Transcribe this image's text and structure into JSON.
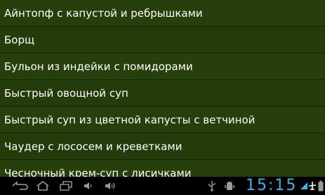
{
  "recipes": [
    "Айнтопф с капустой и ребрышками",
    "Борщ",
    "Бульон из индейки с помидорами",
    "Быстрый овощной суп",
    "Быстрый суп из цветной капусты с ветчиной",
    "Чаудер с лососем и креветками",
    "Чесночный крем-суп с лисичками"
  ],
  "status_bar": {
    "time": "15:15",
    "accent_color": "#33b5e5",
    "icons": [
      "back-icon",
      "home-icon",
      "recent-apps-icon",
      "volume-down-icon",
      "volume-up-icon",
      "usb-icon",
      "android-debug-icon",
      "wifi-icon",
      "airplane-icon",
      "battery-icon"
    ]
  },
  "colors": {
    "list_background": "#263f0b",
    "list_text": "#ffffff",
    "navbar_background": "#000000"
  }
}
